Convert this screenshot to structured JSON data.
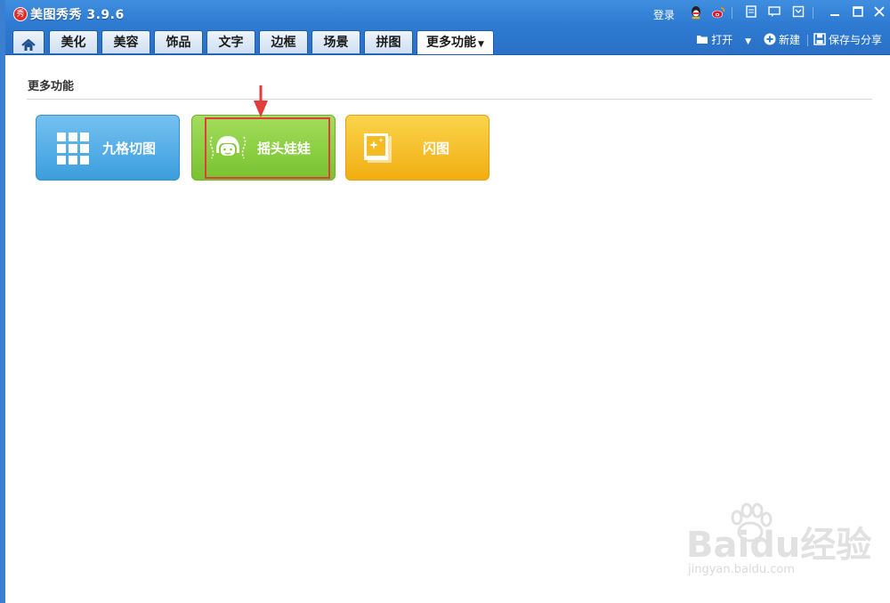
{
  "app": {
    "title": "美图秀秀 3.9.6",
    "icon_name": "meitu-logo-icon"
  },
  "titlebar": {
    "login_label": "登录",
    "icons": [
      "qq-icon",
      "weibo-icon",
      "document-icon",
      "message-icon",
      "restore-box-icon",
      "minimize-icon",
      "maximize-icon",
      "close-icon"
    ]
  },
  "tabs": [
    {
      "label": "",
      "icon": "home-icon"
    },
    {
      "label": "美化"
    },
    {
      "label": "美容"
    },
    {
      "label": "饰品"
    },
    {
      "label": "文字"
    },
    {
      "label": "边框"
    },
    {
      "label": "场景"
    },
    {
      "label": "拼图"
    },
    {
      "label": "更多功能",
      "active": true
    }
  ],
  "toolbar": {
    "open_label": "打开",
    "new_label": "新建",
    "save_label": "保存与分享"
  },
  "section": {
    "title": "更多功能"
  },
  "tools": [
    {
      "label": "九格切图",
      "icon": "grid-icon",
      "color": "#4aa9e4"
    },
    {
      "label": "摇头娃娃",
      "icon": "doll-face-icon",
      "color": "#86c93a",
      "highlighted": true
    },
    {
      "label": "闪图",
      "icon": "sparkle-photo-icon",
      "color": "#f4bb22"
    }
  ],
  "watermark": {
    "brand": "Baidu经验",
    "url": "jingyan.baidu.com"
  }
}
